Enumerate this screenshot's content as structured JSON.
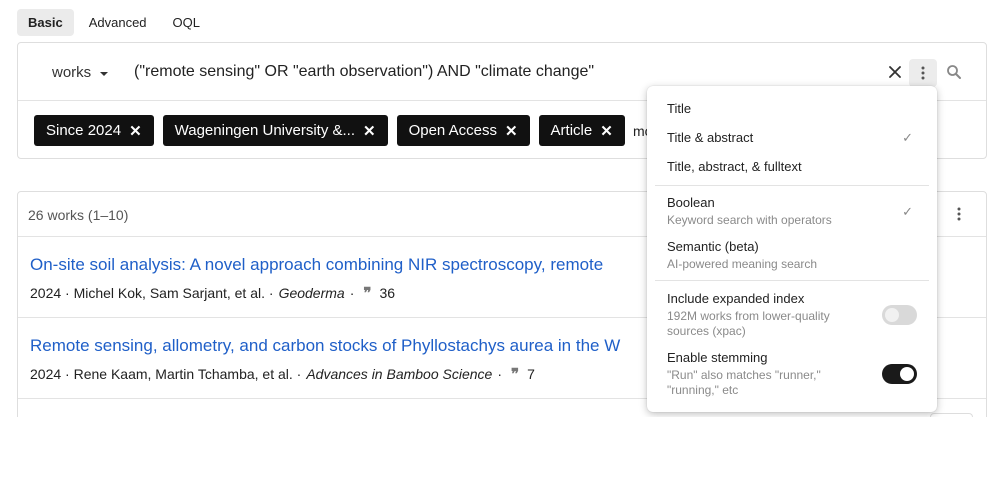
{
  "tabs": [
    {
      "label": "Basic",
      "active": true
    },
    {
      "label": "Advanced",
      "active": false
    },
    {
      "label": "OQL",
      "active": false
    }
  ],
  "search": {
    "entity": "works",
    "query": "(\"remote sensing\" OR \"earth observation\") AND \"climate change\""
  },
  "filters": {
    "chips": [
      "Since 2024",
      "Wageningen University &...",
      "Open Access",
      "Article"
    ],
    "more_label": "mo"
  },
  "results": {
    "count_label": "26 works (1–10)",
    "items": [
      {
        "title": "On-site soil analysis: A novel approach combining NIR spectroscopy, remote",
        "meta_prefix": "2024 · Michel Kok, Sam Sarjant, et al. ·",
        "venue": "Geoderma",
        "meta_suffix": "·",
        "citations": "36"
      },
      {
        "title": "Remote sensing, allometry, and carbon stocks of Phyllostachys aurea in the W",
        "meta_prefix": "2024 · Rene Kaam, Martin Tchamba, et al. ·",
        "venue": "Advances in Bamboo Science",
        "meta_suffix": "·",
        "citations": "7"
      }
    ]
  },
  "menu": {
    "scope": {
      "title": "Title",
      "title_abstract": "Title & abstract",
      "title_abstract_fulltext": "Title, abstract, & fulltext",
      "selected": "title_abstract"
    },
    "mode": {
      "boolean": "Boolean",
      "boolean_desc": "Keyword search with operators",
      "semantic": "Semantic (beta)",
      "semantic_desc": "AI-powered meaning search",
      "selected": "boolean"
    },
    "options": {
      "expanded_label": "Include expanded index",
      "expanded_desc": "192M works from lower-quality sources (xpac)",
      "expanded_on": false,
      "stemming_label": "Enable stemming",
      "stemming_desc": "\"Run\" also matches \"runner,\" \"running,\" etc",
      "stemming_on": true
    },
    "check_glyph": "✓"
  },
  "icons": {
    "clear": "close-icon",
    "more": "more-vertical-icon",
    "search": "search-icon",
    "chip_remove": "close-icon",
    "citations": "quote-icon"
  },
  "colors": {
    "link": "#1f5fc8",
    "chip_bg": "#111111",
    "toggle_on": "#1a1a1a"
  }
}
